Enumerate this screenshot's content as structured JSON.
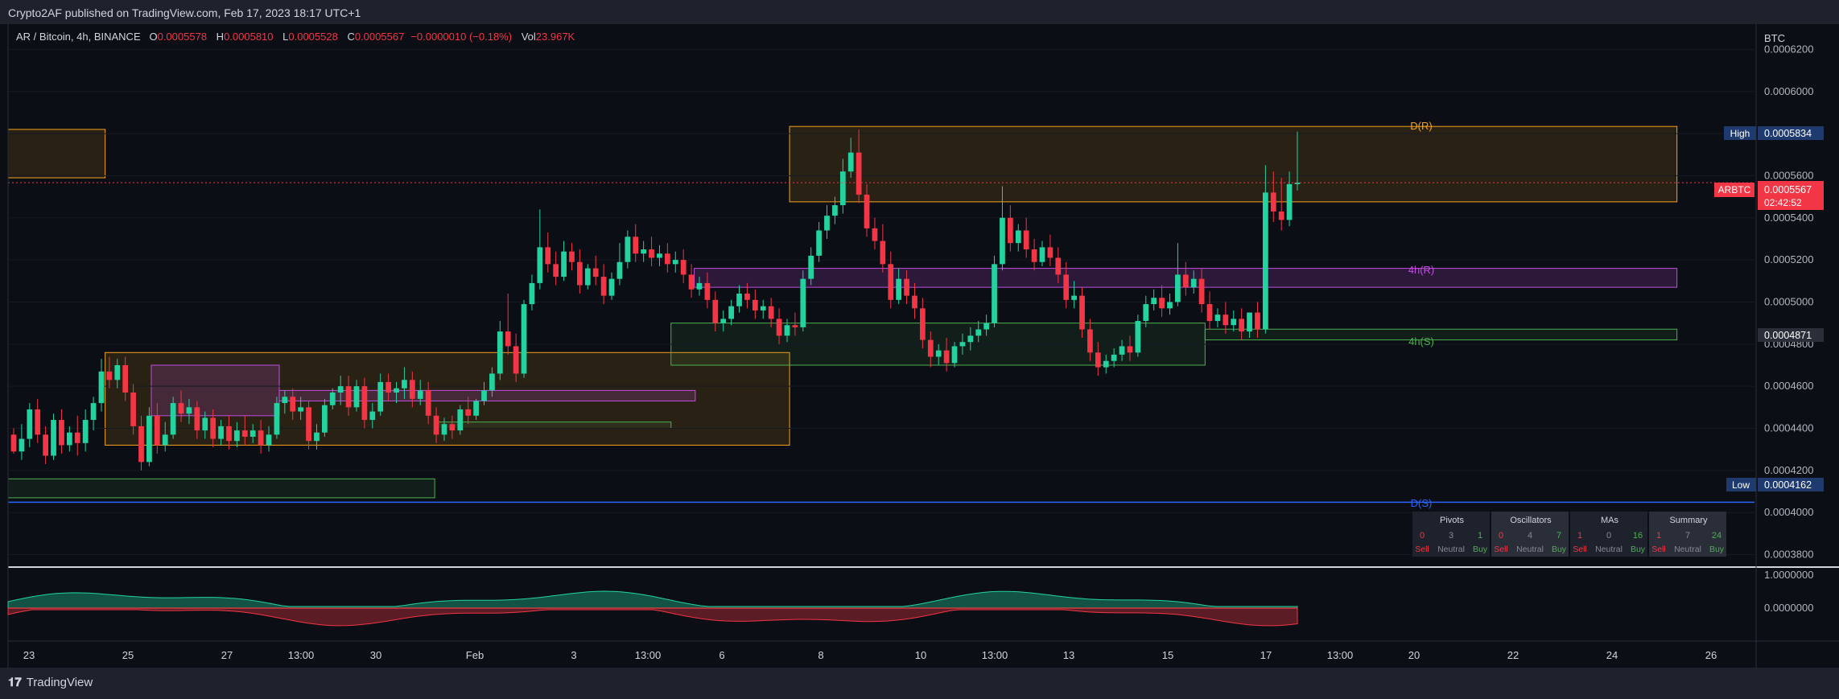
{
  "header": {
    "published": "Crypto2AF published on TradingView.com, Feb 17, 2023 18:17 UTC+1"
  },
  "legend": {
    "symbol": "AR / Bitcoin, 4h, BINANCE",
    "open_label": "O",
    "open": "0.0005578",
    "high_label": "H",
    "high": "0.0005810",
    "low_label": "L",
    "low": "0.0005528",
    "close_label": "C",
    "close": "0.0005567",
    "change": "−0.0000010 (−0.18%)",
    "vol_label": "Vol",
    "vol": "23.967K"
  },
  "footer": {
    "brand": "TradingView",
    "brand_icon": "tradingview-logo-icon"
  },
  "colors": {
    "up": "#22d3a0",
    "down": "#f23645",
    "orange": "#f7a21b",
    "purple": "#c04ee0",
    "green": "#4caf50",
    "blue": "#2962ff"
  },
  "chart_data": {
    "type": "candlestick",
    "currency": "BTC",
    "y_ticks": [
      "0.0006200",
      "0.0006000",
      "0.0005800",
      "0.0005600",
      "0.0005400",
      "0.0005200",
      "0.0005000",
      "0.0004800",
      "0.0004600",
      "0.0004400",
      "0.0004200",
      "0.0004000",
      "0.0003800"
    ],
    "y_tick_values": [
      0.00062,
      0.0006,
      0.00058,
      0.00056,
      0.00054,
      0.00052,
      0.0005,
      0.00048,
      0.00046,
      0.00044,
      0.00042,
      0.0004,
      0.00038
    ],
    "ylim": [
      0.000376,
      0.000632
    ],
    "x_ticks": [
      "23",
      "25",
      "27",
      "13:00",
      "30",
      "Feb",
      "3",
      "13:00",
      "6",
      "8",
      "10",
      "13:00",
      "13",
      "15",
      "17",
      "13:00",
      "20",
      "22",
      "24",
      "26"
    ],
    "price_tags": {
      "high_label": "High",
      "high": "0.0005834",
      "low_label": "Low",
      "low": "0.0004162",
      "symbol_label": "ARBTC",
      "last": "0.0005567",
      "countdown": "02:42:52",
      "support": "0.0004871"
    },
    "zone_labels": {
      "d_r": "D(R)",
      "h4_r": "4h(R)",
      "h4_s": "4h(S)",
      "d_s": "D(S)"
    },
    "oscillator_ticks": [
      "1.0000000",
      "0.0000000"
    ],
    "candles": [
      [
        0.000437,
        0.00044,
        0.000429,
        0.000428
      ],
      [
        0.000429,
        0.000442,
        0.000435,
        0.000425
      ],
      [
        0.000435,
        0.000452,
        0.000449,
        0.000431
      ],
      [
        0.000449,
        0.000454,
        0.000437,
        0.000433
      ],
      [
        0.000437,
        0.000441,
        0.000427,
        0.000423
      ],
      [
        0.000427,
        0.000447,
        0.000444,
        0.000425
      ],
      [
        0.000444,
        0.000449,
        0.000432,
        0.000428
      ],
      [
        0.000432,
        0.000441,
        0.000438,
        0.000429
      ],
      [
        0.000438,
        0.000446,
        0.000433,
        0.000427
      ],
      [
        0.000433,
        0.000449,
        0.000444,
        0.000429
      ],
      [
        0.000444,
        0.000455,
        0.000452,
        0.000439
      ],
      [
        0.000452,
        0.000473,
        0.000467,
        0.000448
      ],
      [
        0.000467,
        0.000474,
        0.000463,
        0.000459
      ],
      [
        0.000463,
        0.000473,
        0.00047,
        0.000459
      ],
      [
        0.00047,
        0.000474,
        0.000457,
        0.000453
      ],
      [
        0.000457,
        0.000461,
        0.000441,
        0.000437
      ],
      [
        0.000441,
        0.000446,
        0.000424,
        0.00042
      ],
      [
        0.000424,
        0.00045,
        0.000446,
        0.000422
      ],
      [
        0.000446,
        0.000452,
        0.000432,
        0.000428
      ],
      [
        0.000432,
        0.000443,
        0.000437,
        0.000429
      ],
      [
        0.000437,
        0.000455,
        0.000452,
        0.000435
      ],
      [
        0.000452,
        0.000458,
        0.000447,
        0.000443
      ],
      [
        0.000447,
        0.000454,
        0.00045,
        0.000442
      ],
      [
        0.00045,
        0.000453,
        0.000439,
        0.000435
      ],
      [
        0.000439,
        0.000448,
        0.000445,
        0.000435
      ],
      [
        0.000445,
        0.000449,
        0.000435,
        0.000431
      ],
      [
        0.000435,
        0.000444,
        0.000441,
        0.000432
      ],
      [
        0.000441,
        0.000446,
        0.000434,
        0.00043
      ],
      [
        0.000434,
        0.000443,
        0.000439,
        0.000431
      ],
      [
        0.000439,
        0.000446,
        0.000436,
        0.000432
      ],
      [
        0.000436,
        0.000442,
        0.000439,
        0.000433
      ],
      [
        0.000439,
        0.000444,
        0.000432,
        0.000428
      ],
      [
        0.000432,
        0.000441,
        0.000437,
        0.000429
      ],
      [
        0.000437,
        0.000455,
        0.000452,
        0.000435
      ],
      [
        0.000452,
        0.000458,
        0.000455,
        0.000447
      ],
      [
        0.000455,
        0.000459,
        0.000448,
        0.000444
      ],
      [
        0.000448,
        0.000455,
        0.00045,
        0.000444
      ],
      [
        0.00045,
        0.000453,
        0.000434,
        0.00043
      ],
      [
        0.000434,
        0.000442,
        0.000438,
        0.00043
      ],
      [
        0.000438,
        0.000454,
        0.000451,
        0.000436
      ],
      [
        0.000451,
        0.000459,
        0.000457,
        0.000449
      ],
      [
        0.000457,
        0.000465,
        0.00046,
        0.000451
      ],
      [
        0.00046,
        0.000465,
        0.00045,
        0.000446
      ],
      [
        0.00045,
        0.000463,
        0.00046,
        0.000448
      ],
      [
        0.00046,
        0.000464,
        0.000444,
        0.00044
      ],
      [
        0.000444,
        0.000452,
        0.000448,
        0.00044
      ],
      [
        0.000448,
        0.000466,
        0.000462,
        0.000446
      ],
      [
        0.000462,
        0.000466,
        0.000457,
        0.000453
      ],
      [
        0.000457,
        0.000462,
        0.000459,
        0.000452
      ],
      [
        0.000459,
        0.000469,
        0.000463,
        0.000454
      ],
      [
        0.000463,
        0.000467,
        0.000454,
        0.00045
      ],
      [
        0.000454,
        0.000463,
        0.000458,
        0.000451
      ],
      [
        0.000458,
        0.000462,
        0.000446,
        0.000442
      ],
      [
        0.000446,
        0.00045,
        0.000437,
        0.000433
      ],
      [
        0.000437,
        0.000445,
        0.000442,
        0.000434
      ],
      [
        0.000442,
        0.000446,
        0.000439,
        0.000435
      ],
      [
        0.000439,
        0.000451,
        0.000449,
        0.000437
      ],
      [
        0.000449,
        0.000455,
        0.000446,
        0.000442
      ],
      [
        0.000446,
        0.000454,
        0.000453,
        0.000444
      ],
      [
        0.000453,
        0.000462,
        0.000458,
        0.000451
      ],
      [
        0.000458,
        0.000469,
        0.000466,
        0.000455
      ],
      [
        0.000466,
        0.000491,
        0.000486,
        0.000463
      ],
      [
        0.000486,
        0.000504,
        0.000479,
        0.000475
      ],
      [
        0.000479,
        0.000485,
        0.000466,
        0.000462
      ],
      [
        0.000466,
        0.000501,
        0.000499,
        0.000464
      ],
      [
        0.000499,
        0.000513,
        0.000509,
        0.000496
      ],
      [
        0.000509,
        0.000544,
        0.000526,
        0.000506
      ],
      [
        0.000526,
        0.000533,
        0.000518,
        0.000514
      ],
      [
        0.000518,
        0.000524,
        0.000512,
        0.000508
      ],
      [
        0.000512,
        0.000529,
        0.000524,
        0.00051
      ],
      [
        0.000524,
        0.000528,
        0.000519,
        0.000515
      ],
      [
        0.000519,
        0.000525,
        0.000508,
        0.000504
      ],
      [
        0.000508,
        0.000518,
        0.000516,
        0.000506
      ],
      [
        0.000516,
        0.000522,
        0.000512,
        0.000508
      ],
      [
        0.000512,
        0.000518,
        0.000503,
        0.000499
      ],
      [
        0.000503,
        0.000514,
        0.000511,
        0.000501
      ],
      [
        0.000511,
        0.000528,
        0.000519,
        0.000508
      ],
      [
        0.000519,
        0.000534,
        0.000531,
        0.000516
      ],
      [
        0.000531,
        0.000537,
        0.000523,
        0.000519
      ],
      [
        0.000523,
        0.000529,
        0.000525,
        0.000519
      ],
      [
        0.000525,
        0.000531,
        0.000521,
        0.000517
      ],
      [
        0.000521,
        0.000527,
        0.000523,
        0.000517
      ],
      [
        0.000523,
        0.000528,
        0.000518,
        0.000514
      ],
      [
        0.000518,
        0.000524,
        0.00052,
        0.000514
      ],
      [
        0.00052,
        0.000525,
        0.000513,
        0.000509
      ],
      [
        0.000513,
        0.000518,
        0.000506,
        0.000502
      ],
      [
        0.000506,
        0.000512,
        0.000509,
        0.000503
      ],
      [
        0.000509,
        0.000514,
        0.000501,
        0.000497
      ],
      [
        0.000501,
        0.000505,
        0.00049,
        0.000486
      ],
      [
        0.00049,
        0.000496,
        0.000492,
        0.000486
      ],
      [
        0.000492,
        0.000501,
        0.000498,
        0.000489
      ],
      [
        0.000498,
        0.000508,
        0.000504,
        0.000495
      ],
      [
        0.000504,
        0.000509,
        0.000501,
        0.000497
      ],
      [
        0.000501,
        0.000506,
        0.000496,
        0.000492
      ],
      [
        0.000496,
        0.000501,
        0.000498,
        0.000492
      ],
      [
        0.000498,
        0.000502,
        0.000492,
        0.000488
      ],
      [
        0.000492,
        0.000497,
        0.000484,
        0.00048
      ],
      [
        0.000484,
        0.000492,
        0.000489,
        0.000481
      ],
      [
        0.000489,
        0.000495,
        0.000488,
        0.000484
      ],
      [
        0.000488,
        0.000515,
        0.000511,
        0.000486
      ],
      [
        0.000511,
        0.000526,
        0.000522,
        0.000508
      ],
      [
        0.000522,
        0.000538,
        0.000534,
        0.000519
      ],
      [
        0.000534,
        0.000546,
        0.000541,
        0.00053
      ],
      [
        0.000541,
        0.00055,
        0.000546,
        0.000537
      ],
      [
        0.000546,
        0.000568,
        0.000562,
        0.000542
      ],
      [
        0.000562,
        0.000578,
        0.000571,
        0.000559
      ],
      [
        0.000571,
        0.000582,
        0.000551,
        0.000547
      ],
      [
        0.000551,
        0.000556,
        0.000535,
        0.000531
      ],
      [
        0.000535,
        0.00054,
        0.000529,
        0.000525
      ],
      [
        0.000529,
        0.000537,
        0.000518,
        0.000514
      ],
      [
        0.000518,
        0.000524,
        0.000501,
        0.000497
      ],
      [
        0.000501,
        0.000516,
        0.000511,
        0.000499
      ],
      [
        0.000511,
        0.000515,
        0.000503,
        0.000499
      ],
      [
        0.000503,
        0.000509,
        0.000497,
        0.000492
      ],
      [
        0.000497,
        0.000502,
        0.000482,
        0.000478
      ],
      [
        0.000482,
        0.000486,
        0.000474,
        0.000469
      ],
      [
        0.000474,
        0.00048,
        0.000477,
        0.00047
      ],
      [
        0.000477,
        0.000483,
        0.000471,
        0.000467
      ],
      [
        0.000471,
        0.000481,
        0.000479,
        0.000469
      ],
      [
        0.000479,
        0.000485,
        0.000481,
        0.000475
      ],
      [
        0.000481,
        0.000488,
        0.000484,
        0.000477
      ],
      [
        0.000484,
        0.000491,
        0.000487,
        0.000481
      ],
      [
        0.000487,
        0.000494,
        0.00049,
        0.000484
      ],
      [
        0.00049,
        0.000522,
        0.000518,
        0.000488
      ],
      [
        0.000518,
        0.000555,
        0.00054,
        0.000515
      ],
      [
        0.00054,
        0.000546,
        0.000528,
        0.000524
      ],
      [
        0.000528,
        0.000537,
        0.000534,
        0.000524
      ],
      [
        0.000534,
        0.00054,
        0.000525,
        0.000521
      ],
      [
        0.000525,
        0.00053,
        0.000519,
        0.000515
      ],
      [
        0.000519,
        0.000529,
        0.000526,
        0.000517
      ],
      [
        0.000526,
        0.000532,
        0.000521,
        0.000517
      ],
      [
        0.000521,
        0.000526,
        0.000513,
        0.000509
      ],
      [
        0.000513,
        0.000519,
        0.000501,
        0.000497
      ],
      [
        0.000501,
        0.00051,
        0.000503,
        0.000497
      ],
      [
        0.000503,
        0.000507,
        0.000487,
        0.000483
      ],
      [
        0.000487,
        0.000492,
        0.000476,
        0.000472
      ],
      [
        0.000476,
        0.000481,
        0.000469,
        0.000465
      ],
      [
        0.000469,
        0.000475,
        0.000472,
        0.000466
      ],
      [
        0.000472,
        0.000478,
        0.000475,
        0.000469
      ],
      [
        0.000475,
        0.000482,
        0.000479,
        0.000472
      ],
      [
        0.000479,
        0.000484,
        0.000476,
        0.000472
      ],
      [
        0.000476,
        0.000494,
        0.000491,
        0.000474
      ],
      [
        0.000491,
        0.000503,
        0.000499,
        0.000488
      ],
      [
        0.000499,
        0.000506,
        0.000502,
        0.000496
      ],
      [
        0.000502,
        0.000508,
        0.000497,
        0.000493
      ],
      [
        0.000497,
        0.000504,
        0.0005,
        0.000494
      ],
      [
        0.0005,
        0.000528,
        0.000513,
        0.000498
      ],
      [
        0.000513,
        0.000519,
        0.000507,
        0.000503
      ],
      [
        0.000507,
        0.000515,
        0.000511,
        0.000504
      ],
      [
        0.000511,
        0.000516,
        0.000499,
        0.000495
      ],
      [
        0.000499,
        0.000505,
        0.000491,
        0.000487
      ],
      [
        0.000491,
        0.000497,
        0.000494,
        0.000488
      ],
      [
        0.000494,
        0.0005,
        0.000489,
        0.000485
      ],
      [
        0.000489,
        0.000496,
        0.000492,
        0.000486
      ],
      [
        0.000492,
        0.000497,
        0.000486,
        0.000482
      ],
      [
        0.000486,
        0.000493,
        0.000495,
        0.000483
      ],
      [
        0.000495,
        0.0005,
        0.000487,
        0.000483
      ],
      [
        0.000487,
        0.000565,
        0.000552,
        0.000485
      ],
      [
        0.000552,
        0.000562,
        0.000543,
        0.000538
      ],
      [
        0.000543,
        0.000559,
        0.000539,
        0.000534
      ],
      [
        0.000539,
        0.000562,
        0.000556,
        0.000536
      ],
      [
        0.000556,
        0.000581,
        0.0005567,
        0.000553
      ]
    ],
    "zones": [
      {
        "name": "left-orange-zone",
        "kind": "orange",
        "x0": 0,
        "x1": 0.0556,
        "y_top": 0.000582,
        "y_bottom": 0.000559
      },
      {
        "name": "dr-zone",
        "kind": "orange",
        "x0": 0.4475,
        "x1": 0.9556,
        "y_top": 0.0005834,
        "y_bottom": 0.0005476
      },
      {
        "name": "mid-orange-zone",
        "kind": "orange",
        "x0": 0.0556,
        "x1": 0.4475,
        "y_top": 0.000476,
        "y_bottom": 0.000432
      },
      {
        "name": "h4r-zone",
        "kind": "purple",
        "x0": 0.3929,
        "x1": 0.9556,
        "y_top": 0.000516,
        "y_bottom": 0.000507
      },
      {
        "name": "left-purple-zone",
        "kind": "purple",
        "x0": 0.082,
        "x1": 0.1553,
        "y_top": 0.00047,
        "y_bottom": 0.000446
      },
      {
        "name": "small-purple-zone",
        "kind": "purple",
        "x0": 0.1553,
        "x1": 0.3935,
        "y_top": 0.000458,
        "y_bottom": 0.000453
      },
      {
        "name": "h4s-zone",
        "kind": "green",
        "x0": 0.6854,
        "x1": 0.9556,
        "y_top": 0.0004871,
        "y_bottom": 0.000482
      },
      {
        "name": "mid-green-zone",
        "kind": "green",
        "x0": 0.3796,
        "x1": 0.6854,
        "y_top": 0.00049,
        "y_bottom": 0.00047
      },
      {
        "name": "small-green-zone",
        "kind": "green",
        "x0": 0.2443,
        "x1": 0.3796,
        "y_top": 0.000443,
        "y_bottom": 0.00044
      },
      {
        "name": "low-green-zone",
        "kind": "green",
        "x0": 0,
        "x1": 0.2443,
        "y_top": 0.000416,
        "y_bottom": 0.000407
      }
    ],
    "table": {
      "groups": [
        {
          "title": "Pivots",
          "sell": "0",
          "neutral": "3",
          "buy": "1"
        },
        {
          "title": "Oscillators",
          "sell": "0",
          "neutral": "4",
          "buy": "7"
        },
        {
          "title": "MAs",
          "sell": "1",
          "neutral": "0",
          "buy": "16"
        },
        {
          "title": "Summary",
          "sell": "1",
          "neutral": "7",
          "buy": "24"
        }
      ],
      "sell_label": "Sell",
      "neutral_label": "Neutral",
      "buy_label": "Buy"
    }
  }
}
